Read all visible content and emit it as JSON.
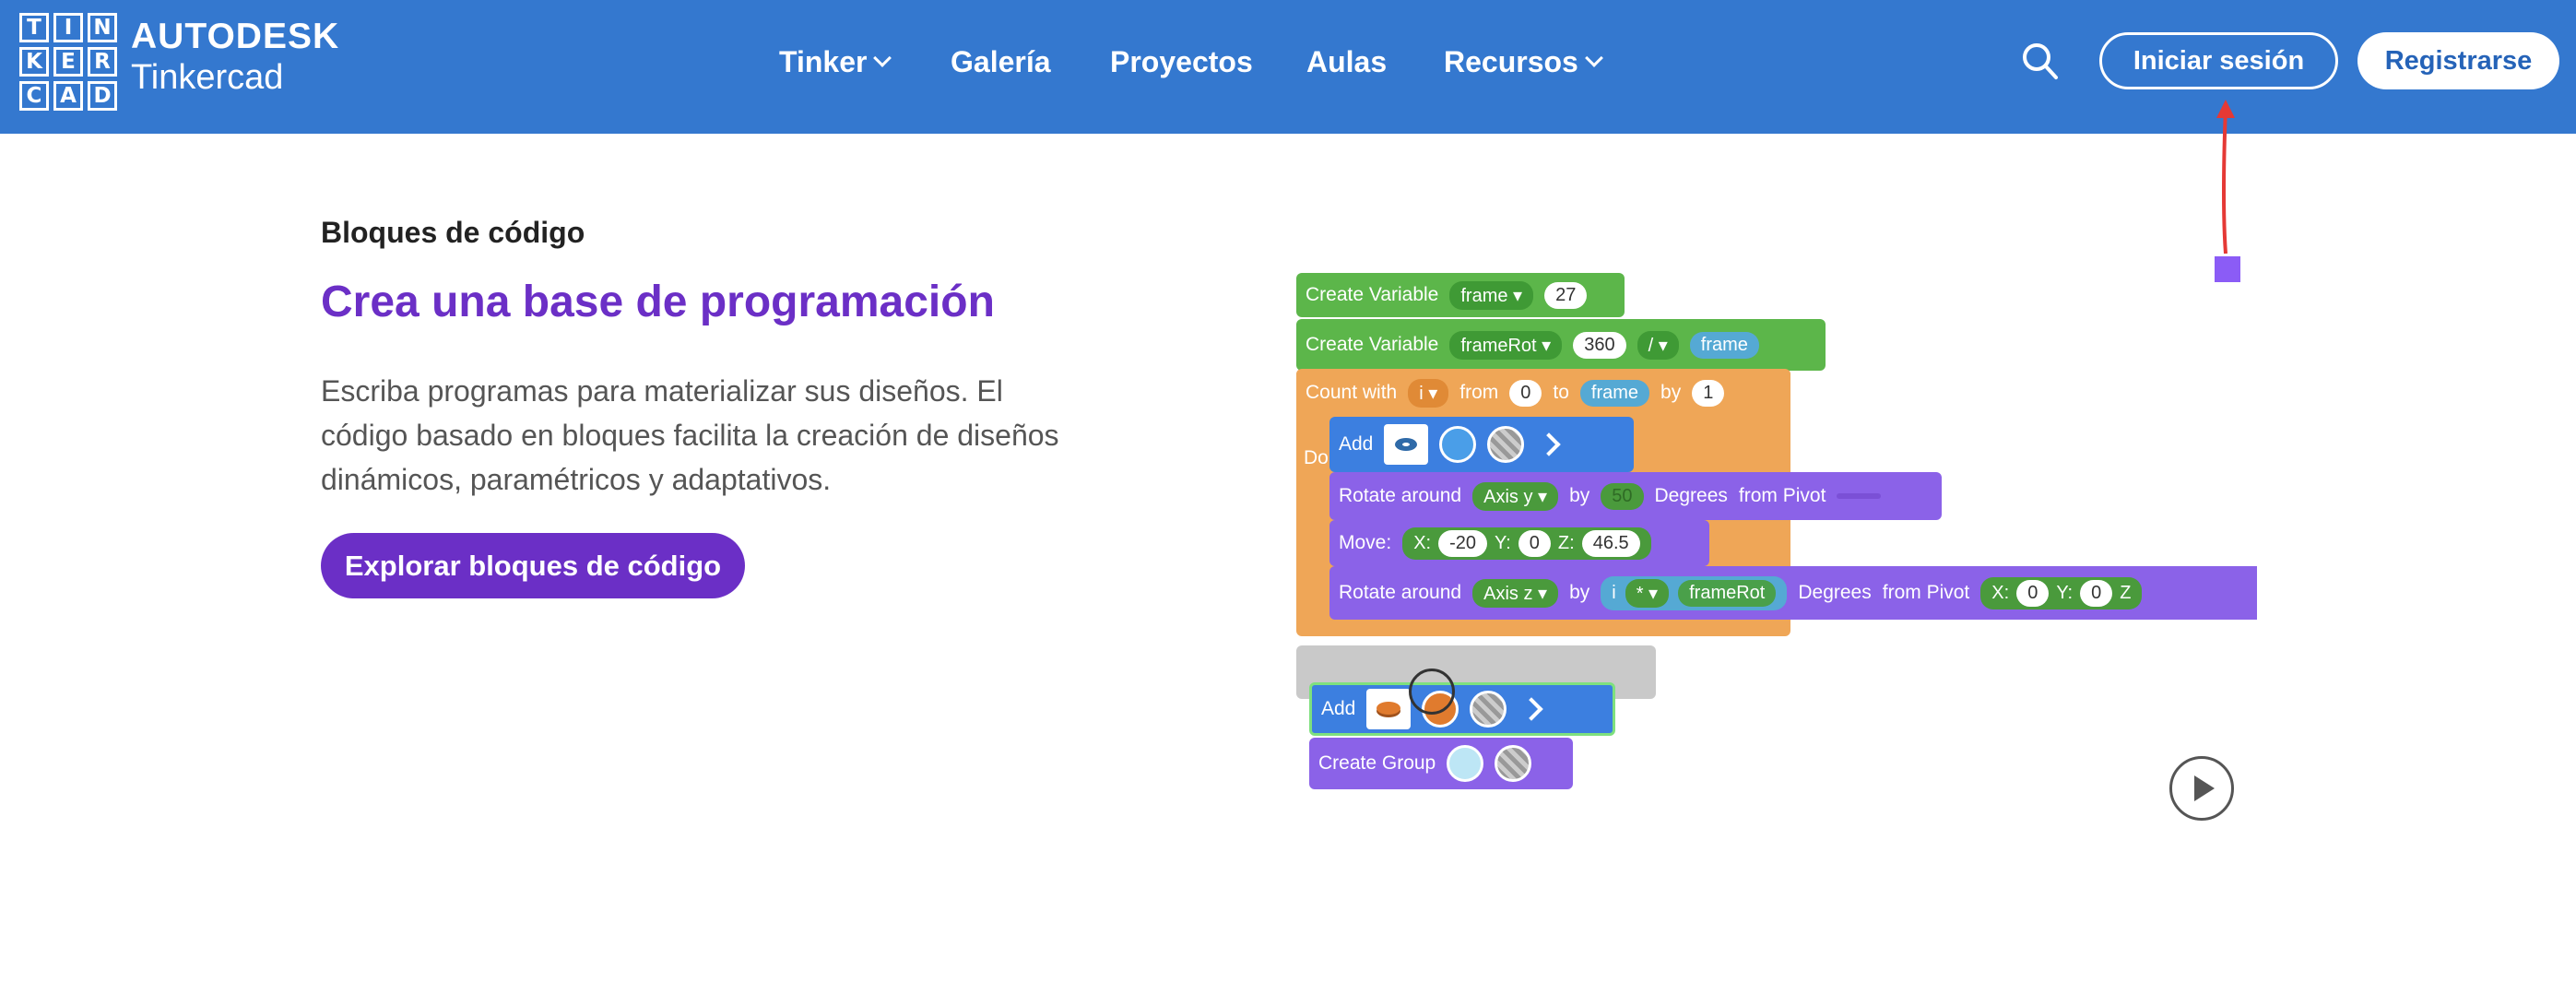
{
  "logo": {
    "letters": [
      "T",
      "I",
      "N",
      "K",
      "E",
      "R",
      "C",
      "A",
      "D"
    ],
    "brand_top": "AUTODESK",
    "brand_bottom": "Tinkercad"
  },
  "nav": {
    "items": [
      {
        "label": "Tinker",
        "has_dropdown": true
      },
      {
        "label": "Galería",
        "has_dropdown": false
      },
      {
        "label": "Proyectos",
        "has_dropdown": false
      },
      {
        "label": "Aulas",
        "has_dropdown": false
      },
      {
        "label": "Recursos",
        "has_dropdown": true
      }
    ],
    "search_icon": "search-icon",
    "login_label": "Iniciar sesión",
    "register_label": "Registrarse"
  },
  "section": {
    "eyebrow": "Bloques de código",
    "headline": "Crea una base de programación",
    "description": "Escriba programas para materializar sus diseños. El código basado en bloques facilita la creación de diseños dinámicos, paramétricos y adaptativos.",
    "cta_label": "Explorar bloques de código"
  },
  "code_blocks": {
    "row1": {
      "label": "Create Variable",
      "var": "frame",
      "value": "27"
    },
    "row2": {
      "label": "Create Variable",
      "var": "frameRot",
      "value": "360",
      "op": "/",
      "ref": "frame"
    },
    "row3": {
      "label": "Count with",
      "var": "i",
      "from_label": "from",
      "from": "0",
      "to_label": "to",
      "to": "frame",
      "by_label": "by",
      "by": "1"
    },
    "do_label": "Do",
    "row4": {
      "label": "Add"
    },
    "row5": {
      "label": "Rotate around",
      "axis": "Axis y",
      "by_label": "by",
      "value": "50",
      "degrees": "Degrees",
      "pivot": "from Pivot"
    },
    "row6": {
      "label": "Move:",
      "x_label": "X:",
      "x": "-20",
      "y_label": "Y:",
      "y": "0",
      "z_label": "Z:",
      "z": "46.5"
    },
    "row7": {
      "label": "Rotate around",
      "axis": "Axis z",
      "by_label": "by",
      "var": "i",
      "op": "*",
      "ref": "frameRot",
      "degrees": "Degrees",
      "pivot": "from Pivot",
      "x_label": "X:",
      "x": "0",
      "y_label": "Y:",
      "y": "0",
      "z_label": "Z"
    },
    "row8": {
      "label": "Add"
    },
    "row9": {
      "label": "Create Group"
    }
  },
  "colors": {
    "header": "#3478cf",
    "accent_purple": "#6b2fc6",
    "annotation_arrow": "#e53935",
    "annotation_marker": "#8b5cf6"
  },
  "icons": {
    "play": "play-icon"
  }
}
